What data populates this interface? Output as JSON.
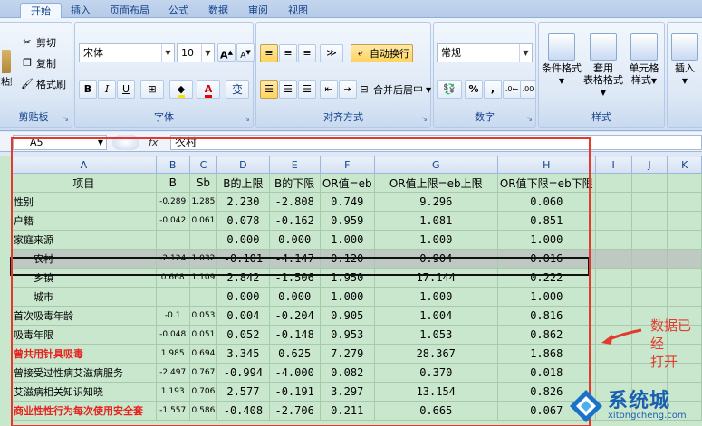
{
  "tabs": [
    "开始",
    "插入",
    "页面布局",
    "公式",
    "数据",
    "审阅",
    "视图"
  ],
  "ribbon": {
    "clipboard": {
      "paste_partial": "粘贴",
      "cut": "剪切",
      "copy": "复制",
      "format_painter": "格式刷",
      "label": "剪贴板"
    },
    "font": {
      "name": "宋体",
      "size": "10",
      "grow": "A",
      "shrink": "A",
      "bold": "B",
      "italic": "I",
      "underline": "U",
      "font_color": "A",
      "phonetic": "变",
      "label": "字体"
    },
    "alignment": {
      "wrap": "自动换行",
      "merge": "合并后居中",
      "label": "对齐方式"
    },
    "number": {
      "format": "常规",
      "percent": "%",
      "comma": ",",
      "label": "数字"
    },
    "styles": {
      "conditional": "条件格式",
      "table_format_1": "套用",
      "table_format_2": "表格格式",
      "cell_style_1": "单元格",
      "cell_style_2": "样式",
      "label": "样式"
    },
    "cells": {
      "insert": "插入"
    }
  },
  "formula_bar": {
    "name_box": "A5",
    "fx": "fx",
    "content": "农村"
  },
  "columns": [
    "A",
    "B",
    "C",
    "D",
    "E",
    "F",
    "G",
    "H",
    "I",
    "J",
    "K"
  ],
  "header_row": [
    "项目",
    "B",
    "Sb",
    "B的上限",
    "B的下限",
    "OR值=eb",
    "OR值上限=eb上限",
    "OR值下限=eb下限"
  ],
  "rows": [
    {
      "label": "性别",
      "b": "-0.289",
      "sb": "1.285",
      "d": "2.230",
      "e": "-2.808",
      "f": "0.749",
      "g": "9.296",
      "h": "0.060",
      "indent": false,
      "red": false
    },
    {
      "label": "户籍",
      "b": "-0.042",
      "sb": "0.061",
      "d": "0.078",
      "e": "-0.162",
      "f": "0.959",
      "g": "1.081",
      "h": "0.851",
      "indent": false,
      "red": false
    },
    {
      "label": "家庭来源",
      "b": "",
      "sb": "",
      "d": "0.000",
      "e": "0.000",
      "f": "1.000",
      "g": "1.000",
      "h": "1.000",
      "indent": false,
      "red": false
    },
    {
      "label": "农村",
      "b": "-2.124",
      "sb": "1.032",
      "d": "-0.101",
      "e": "-4.147",
      "f": "0.120",
      "g": "0.904",
      "h": "0.016",
      "indent": true,
      "red": false,
      "selected": true
    },
    {
      "label": "乡镇",
      "b": "0.668",
      "sb": "1.109",
      "d": "2.842",
      "e": "-1.506",
      "f": "1.950",
      "g": "17.144",
      "h": "0.222",
      "indent": true,
      "red": false
    },
    {
      "label": "城市",
      "b": "",
      "sb": "",
      "d": "0.000",
      "e": "0.000",
      "f": "1.000",
      "g": "1.000",
      "h": "1.000",
      "indent": true,
      "red": false
    },
    {
      "label": "首次吸毒年龄",
      "b": "-0.1",
      "sb": "0.053",
      "d": "0.004",
      "e": "-0.204",
      "f": "0.905",
      "g": "1.004",
      "h": "0.816",
      "indent": false,
      "red": false
    },
    {
      "label": "吸毒年限",
      "b": "-0.048",
      "sb": "0.051",
      "d": "0.052",
      "e": "-0.148",
      "f": "0.953",
      "g": "1.053",
      "h": "0.862",
      "indent": false,
      "red": false
    },
    {
      "label": "曾共用针具吸毒",
      "b": "1.985",
      "sb": "0.694",
      "d": "3.345",
      "e": "0.625",
      "f": "7.279",
      "g": "28.367",
      "h": "1.868",
      "indent": false,
      "red": true
    },
    {
      "label": "曾接受过性病艾滋病服务",
      "b": "-2.497",
      "sb": "0.767",
      "d": "-0.994",
      "e": "-4.000",
      "f": "0.082",
      "g": "0.370",
      "h": "0.018",
      "indent": false,
      "red": false
    },
    {
      "label": "艾滋病相关知识知晓",
      "b": "1.193",
      "sb": "0.706",
      "d": "2.577",
      "e": "-0.191",
      "f": "3.297",
      "g": "13.154",
      "h": "0.826",
      "indent": false,
      "red": false
    },
    {
      "label": "商业性性行为每次使用安全套",
      "b": "-1.557",
      "sb": "0.586",
      "d": "-0.408",
      "e": "-2.706",
      "f": "0.211",
      "g": "0.665",
      "h": "0.067",
      "indent": false,
      "red": true
    }
  ],
  "annotation": {
    "line1": "数据已经",
    "line2": "打开"
  },
  "watermark": {
    "brand": "系统城",
    "url": "xitongcheng.com"
  }
}
